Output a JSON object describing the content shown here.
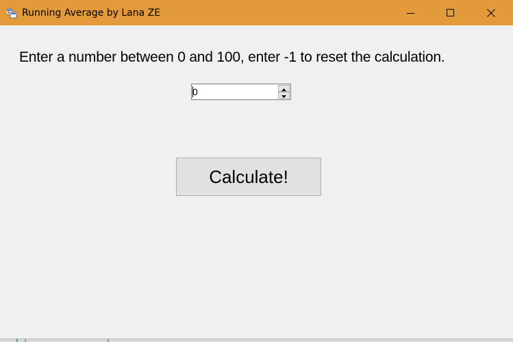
{
  "window": {
    "title": "Running Average by Lana ZE",
    "titlebar_color": "#e39a3a",
    "icons": {
      "app": "app-icon",
      "minimize": "minimize-icon",
      "maximize": "maximize-icon",
      "close": "close-icon"
    }
  },
  "form": {
    "instruction": "Enter a number between 0 and 100, enter -1 to reset the calculation.",
    "number_input_value": "0",
    "spin_up_icon": "spin-up-arrow-icon",
    "spin_down_icon": "spin-down-arrow-icon",
    "calculate_label": "Calculate!"
  }
}
